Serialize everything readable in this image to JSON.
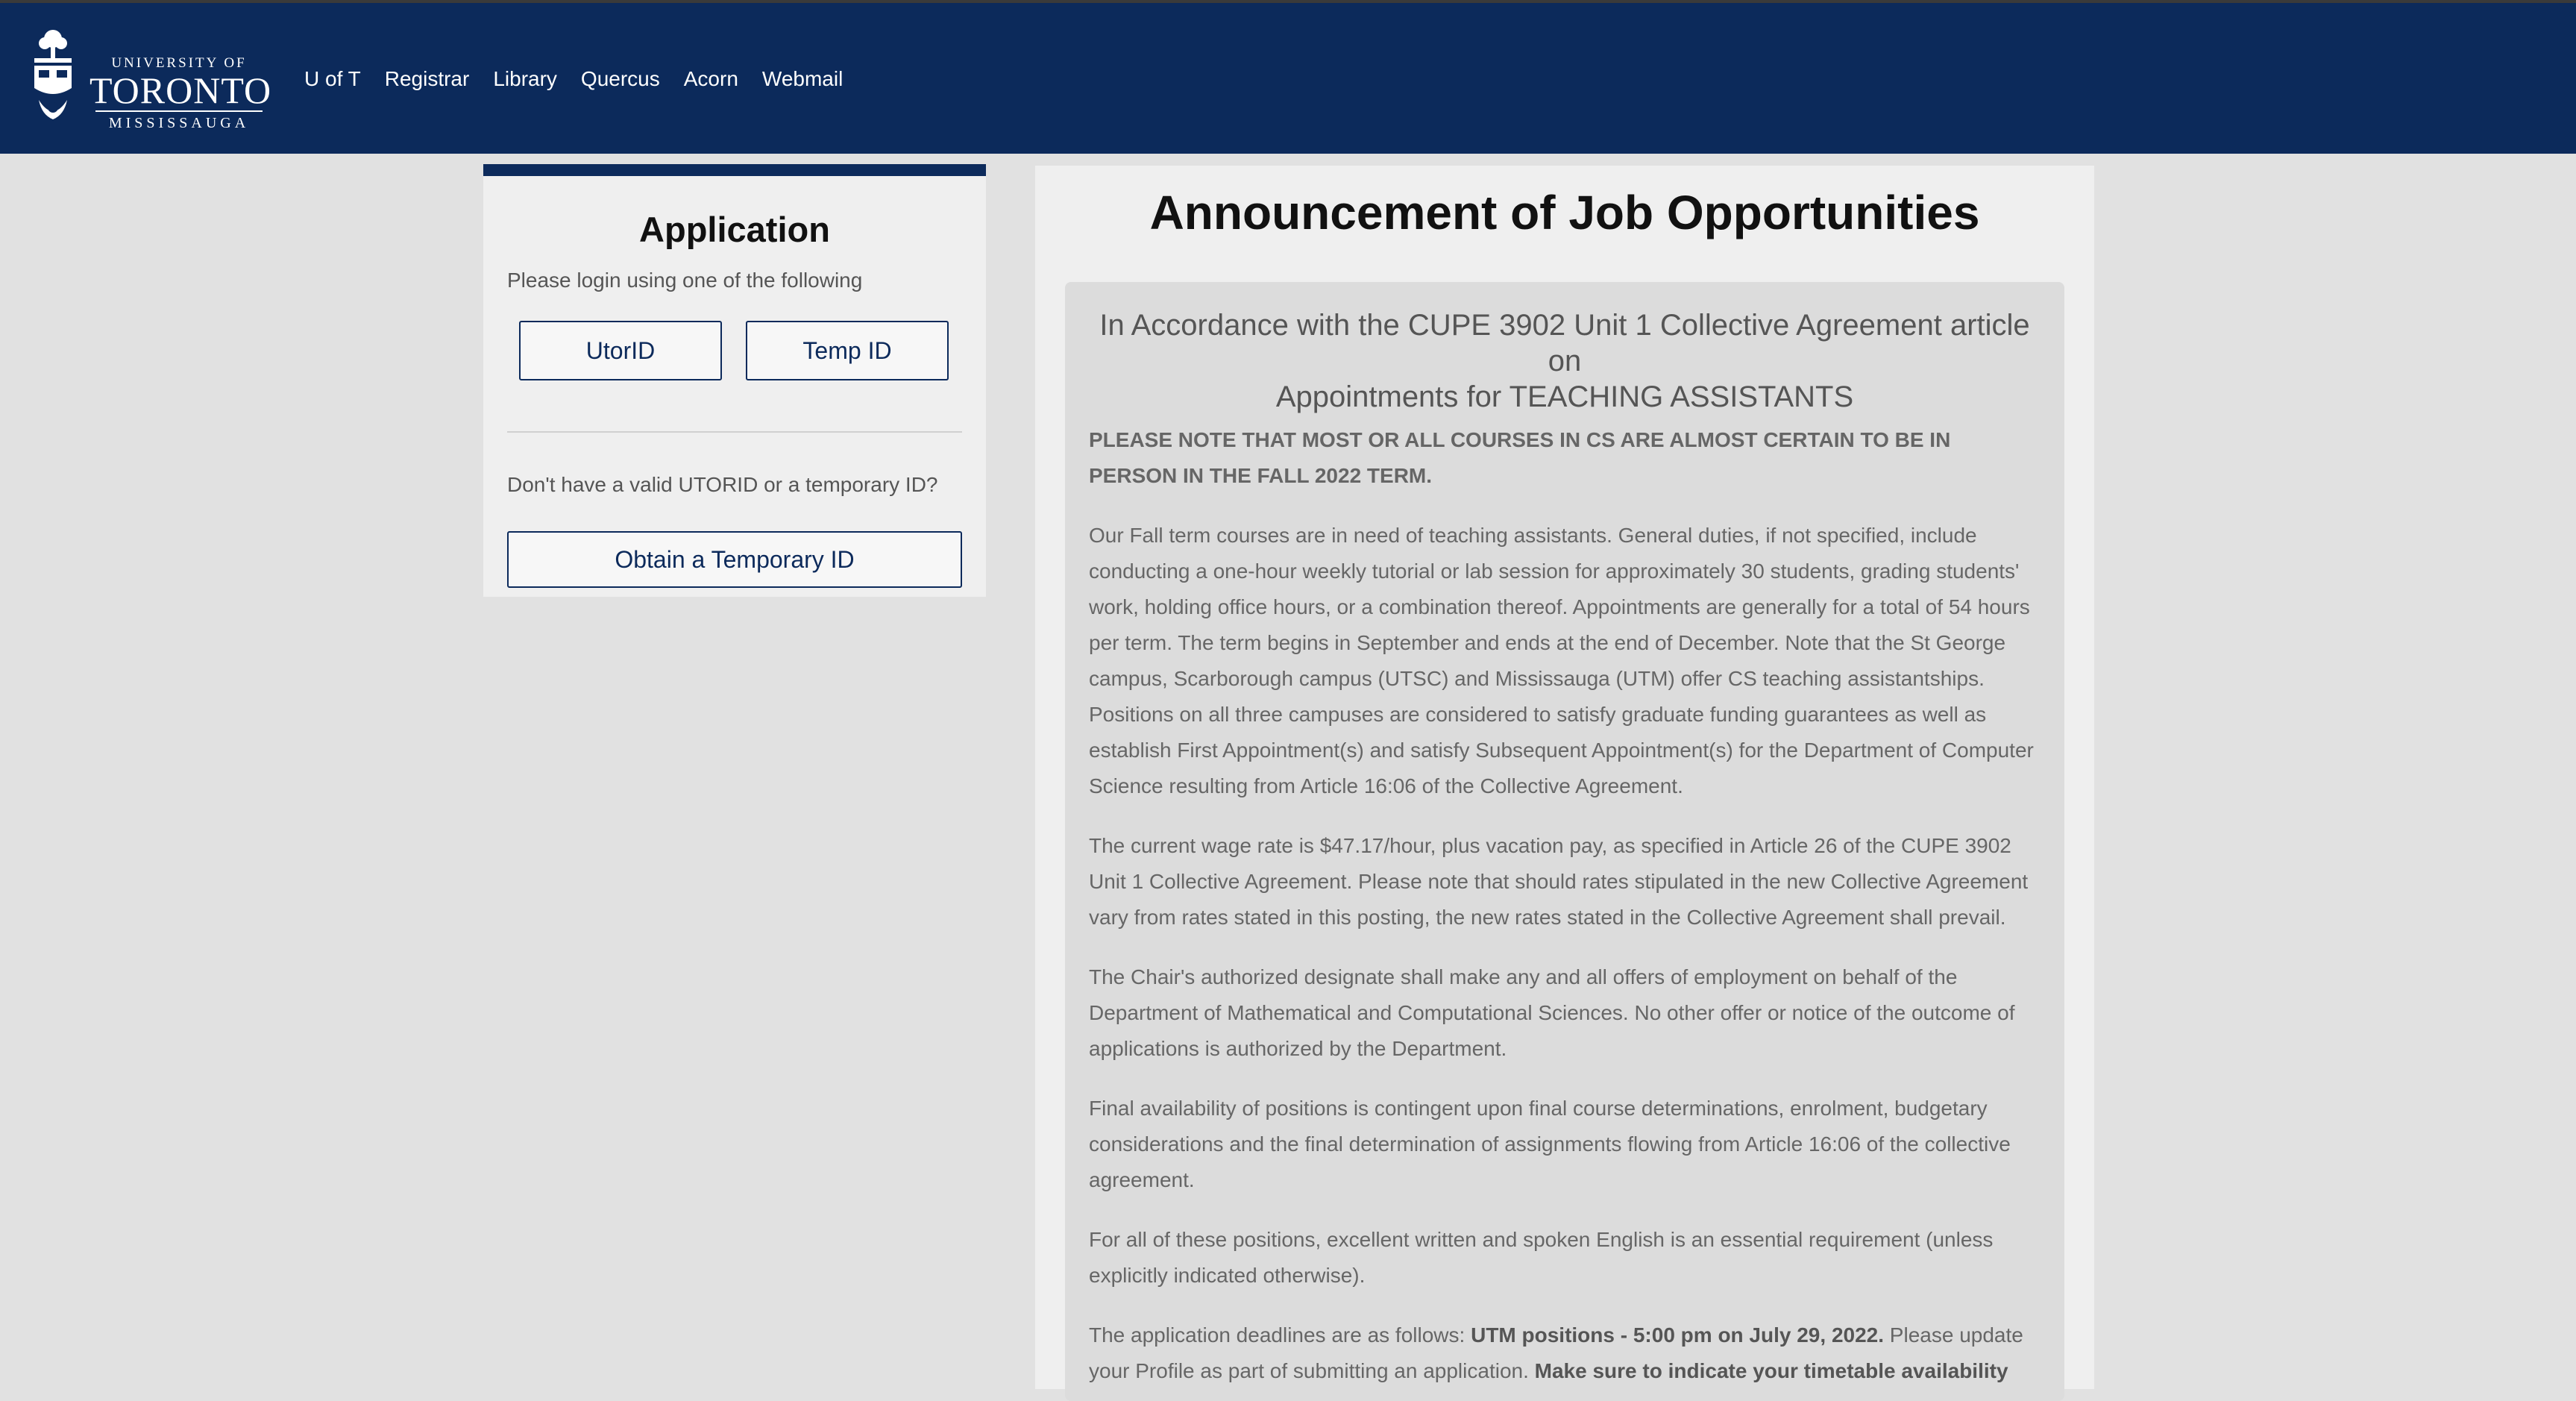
{
  "header": {
    "logo": {
      "line1": "UNIVERSITY OF",
      "line2": "TORONTO",
      "line3": "MISSISSAUGA"
    },
    "nav": [
      "U of T",
      "Registrar",
      "Library",
      "Quercus",
      "Acorn",
      "Webmail"
    ]
  },
  "application": {
    "title": "Application",
    "subtitle": "Please login using one of the following",
    "utorid_label": "UtorID",
    "tempid_label": "Temp ID",
    "question": "Don't have a valid UTORID or a temporary ID?",
    "obtain_label": "Obtain a Temporary ID"
  },
  "announcement": {
    "title": "Announcement of Job Opportunities",
    "heading_line1": "In Accordance with the CUPE 3902 Unit 1 Collective Agreement article",
    "heading_line2": "on",
    "heading_line3": "Appointments for TEACHING ASSISTANTS",
    "note": "PLEASE NOTE THAT MOST OR ALL COURSES IN CS ARE ALMOST CERTAIN TO BE IN PERSON IN THE FALL 2022 TERM.",
    "p1": "Our Fall term courses are in need of teaching assistants. General duties, if not specified, include conducting a one-hour weekly tutorial or lab session for approximately 30 students, grading students' work, holding office hours, or a combination thereof. Appointments are generally for a total of 54 hours per term. The term begins in September and ends at the end of December. Note that the St George campus, Scarborough campus (UTSC) and Mississauga (UTM) offer CS teaching assistantships. Positions on all three campuses are considered to satisfy graduate funding guarantees as well as establish First Appointment(s) and satisfy Subsequent Appointment(s) for the Department of Computer Science resulting from Article 16:06 of the Collective Agreement.",
    "p2": "The current wage rate is $47.17/hour, plus vacation pay, as specified in Article 26 of the CUPE 3902 Unit 1 Collective Agreement. Please note that should rates stipulated in the new Collective Agreement vary from rates stated in this posting, the new rates stated in the Collective Agreement shall prevail.",
    "p3": "The Chair's authorized designate shall make any and all offers of employment on behalf of the Department of Mathematical and Computational Sciences. No other offer or notice of the outcome of applications is authorized by the Department.",
    "p4": "Final availability of positions is contingent upon final course determinations, enrolment, budgetary considerations and the final determination of assignments flowing from Article 16:06 of the collective agreement.",
    "p5": "For all of these positions, excellent written and spoken English is an essential requirement (unless explicitly indicated otherwise).",
    "p6_start": "The application deadlines are as follows: ",
    "p6_bold": "UTM positions - 5:00 pm on July 29, 2022.",
    "p6_mid": " Please update your Profile as part of submitting an application. ",
    "p6_bold2": "Make sure to indicate your timetable availability"
  }
}
